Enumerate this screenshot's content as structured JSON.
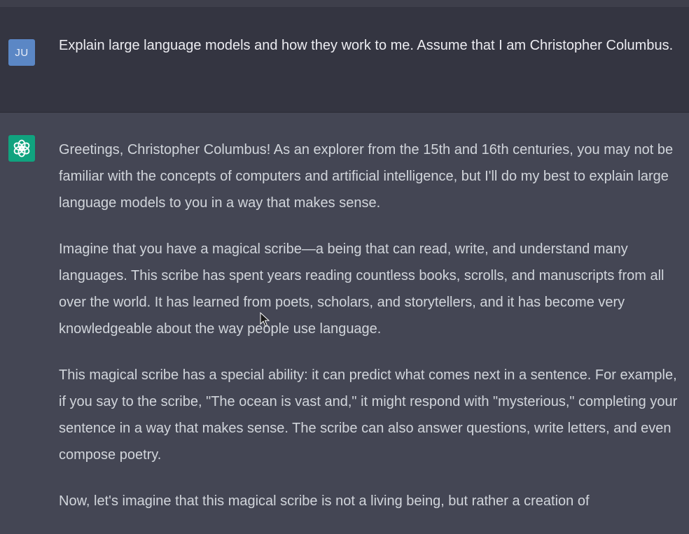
{
  "user": {
    "avatar_initials": "JU",
    "message": "Explain large language models and how they work to me. Assume that I am Christopher Columbus."
  },
  "assistant": {
    "avatar_icon": "openai-logo-icon",
    "paragraphs": [
      "Greetings, Christopher Columbus! As an explorer from the 15th and 16th centuries, you may not be familiar with the concepts of computers and artificial intelligence, but I'll do my best to explain large language models to you in a way that makes sense.",
      "Imagine that you have a magical scribe—a being that can read, write, and understand many languages. This scribe has spent years reading countless books, scrolls, and manuscripts from all over the world. It has learned from poets, scholars, and storytellers, and it has become very knowledgeable about the way people use language.",
      "This magical scribe has a special ability: it can predict what comes next in a sentence. For example, if you say to the scribe, \"The ocean is vast and,\" it might respond with \"mysterious,\" completing your sentence in a way that makes sense. The scribe can also answer questions, write letters, and even compose poetry.",
      "Now, let's imagine that this magical scribe is not a living being, but rather a creation of"
    ]
  },
  "colors": {
    "user_bg": "#343541",
    "assistant_bg": "#444654",
    "user_avatar": "#5b87c5",
    "bot_avatar": "#10a37f"
  }
}
